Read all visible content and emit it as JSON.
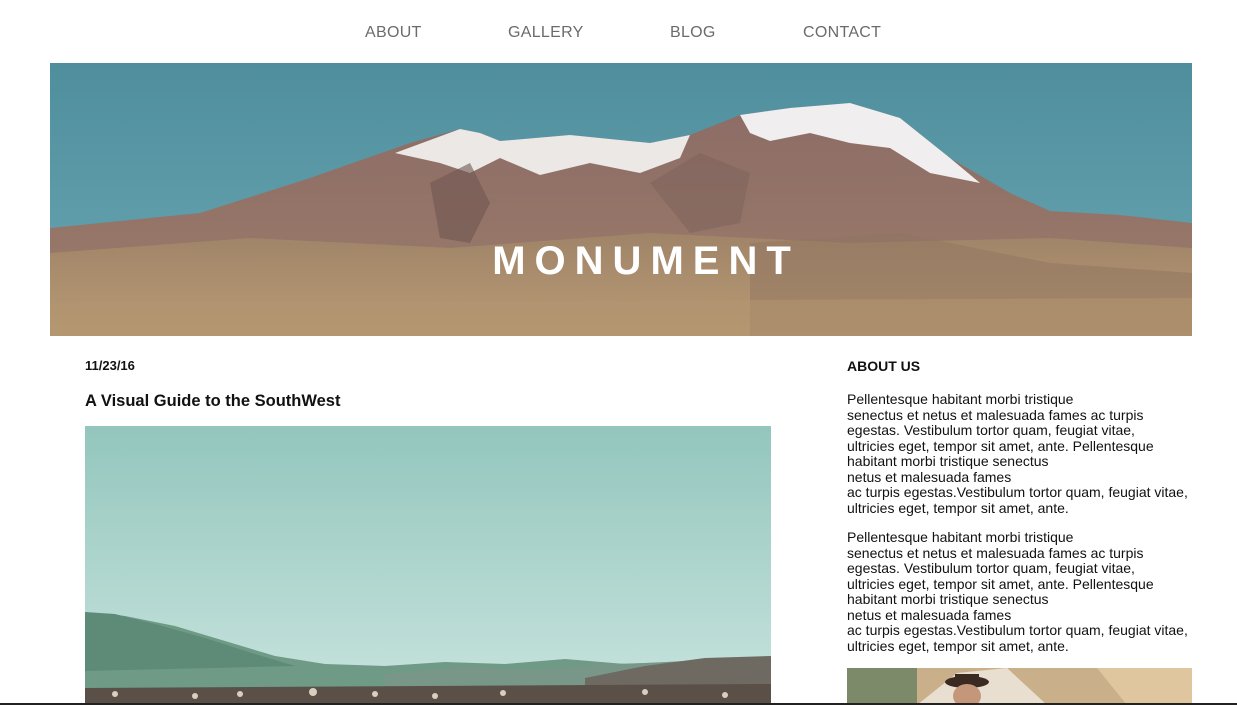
{
  "nav": {
    "links": [
      {
        "label": "ABOUT"
      },
      {
        "label": "GALLERY"
      },
      {
        "label": "BLOG"
      },
      {
        "label": "CONTACT"
      }
    ]
  },
  "hero": {
    "title": "MONUMENT"
  },
  "post": {
    "date": "11/23/16",
    "title": "A Visual Guide to the SouthWest"
  },
  "sidebar": {
    "heading": "ABOUT US",
    "paragraphs": [
      "Pellentesque habitant morbi tristique\nsenectus et netus et malesuada fames ac turpis\negestas. Vestibulum tortor quam, feugiat vitae,\nultricies eget, tempor sit amet, ante. Pellentesque\nhabitant morbi tristique senectus\nnetus et malesuada fames\nac turpis egestas.Vestibulum tortor quam, feugiat vitae,\nultricies eget, tempor sit amet, ante.",
      "Pellentesque habitant morbi tristique\nsenectus et netus et malesuada fames ac turpis\negestas. Vestibulum tortor quam, feugiat vitae,\nultricies eget, tempor sit amet, ante. Pellentesque\nhabitant morbi tristique senectus\nnetus et malesuada fames\nac turpis egestas.Vestibulum tortor quam, feugiat vitae,\nultricies eget, tempor sit amet, ante."
    ]
  },
  "colors": {
    "sky": "#5a97a4",
    "snow": "#eeeeee",
    "mountain": "#8a6a60",
    "ground": "#a98b6a",
    "nav_text": "#6b6b6b",
    "post_sky": "#9fcfc6"
  }
}
